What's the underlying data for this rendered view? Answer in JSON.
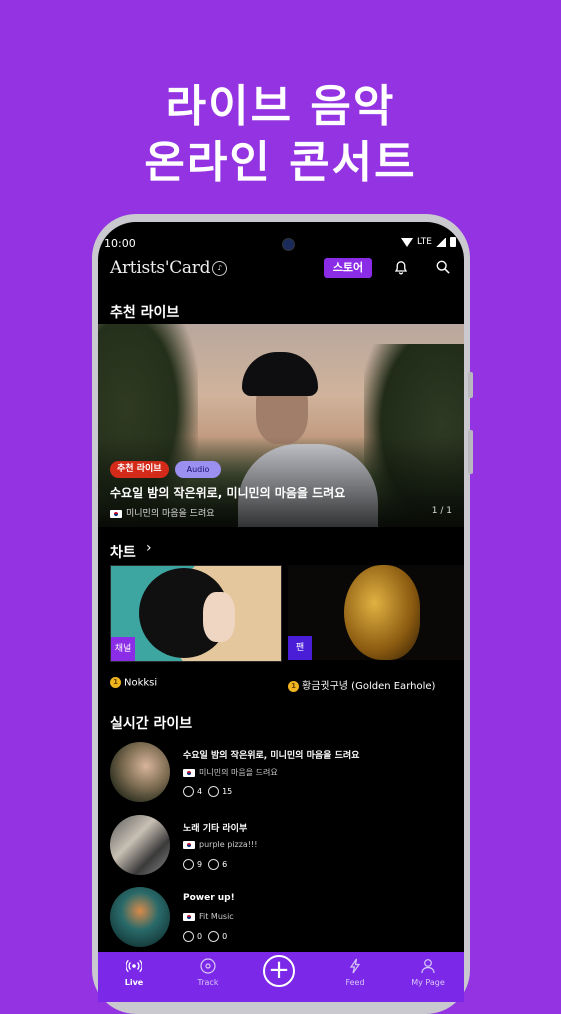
{
  "promo": {
    "line1": "라이브 음악",
    "line2": "온라인 콘서트"
  },
  "status": {
    "time": "10:00",
    "network": "LTE"
  },
  "header": {
    "logo": "Artists'Card",
    "store": "스토어"
  },
  "recommended": {
    "title": "추천 라이브",
    "tag": "추천 라이브",
    "media_type": "Audio",
    "live_title": "수요일 밤의 작은위로, 미니민의 마음을 드려요",
    "channel": "미니민의 마음을 드려요",
    "pager": "1 / 1"
  },
  "chart": {
    "title": "차트",
    "cards": [
      {
        "tag": "채널",
        "rank": "1",
        "name": "Nokksi"
      },
      {
        "tag": "팬",
        "rank": "1",
        "name": "황금귓구녕 (Golden Earhole)"
      }
    ]
  },
  "live": {
    "title": "실시간 라이브",
    "items": [
      {
        "title": "수요일 밤의 작은위로, 미니민의 마음을 드려요",
        "channel": "미니민의 마음을 드려요",
        "likes": "4",
        "viewers": "15"
      },
      {
        "title": "노래 기타 라이부",
        "channel": "purple pizza!!!",
        "likes": "9",
        "viewers": "6"
      },
      {
        "title": "Power up!",
        "channel": "Fit Music",
        "likes": "0",
        "viewers": "0"
      }
    ]
  },
  "tabs": {
    "live": "Live",
    "track": "Track",
    "create": "+",
    "feed": "Feed",
    "mypage": "My Page"
  },
  "colors": {
    "background": "#9333e2",
    "accent": "#8b2ce6",
    "tabbar": "#7b28e8",
    "tag_red": "#d42a1a"
  }
}
